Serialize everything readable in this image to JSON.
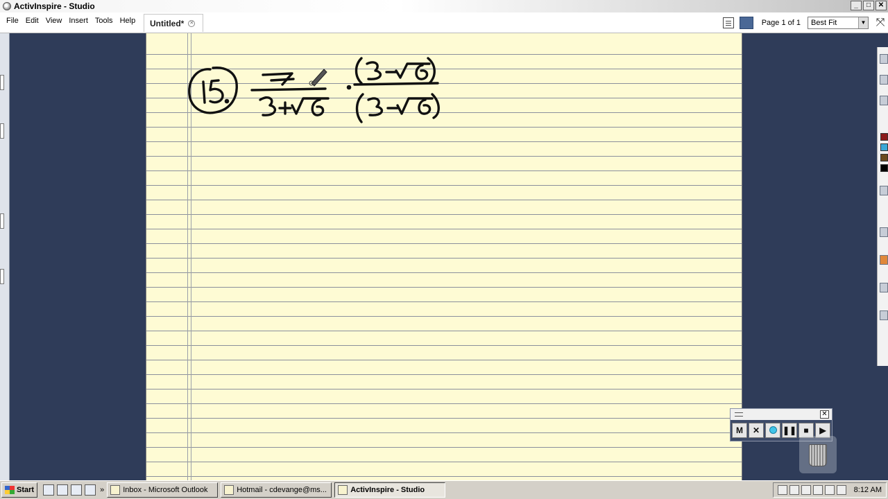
{
  "window": {
    "title": "ActivInspire - Studio",
    "controls": [
      "_",
      "□",
      "✕"
    ]
  },
  "menu": {
    "items": [
      "File",
      "Edit",
      "View",
      "Insert",
      "Tools",
      "Help"
    ]
  },
  "document_tab": {
    "label": "Untitled*"
  },
  "toolbar": {
    "page_label": "Page 1 of 1",
    "zoom_value": "Best Fit"
  },
  "recorder": {
    "buttons": [
      "M",
      "✕",
      "record",
      "❚❚",
      "■",
      "▶"
    ]
  },
  "taskbar": {
    "start_label": "Start",
    "tasks": [
      {
        "label": "Inbox - Microsoft Outlook",
        "active": false
      },
      {
        "label": "Hotmail - cdevange@ms...",
        "active": false
      },
      {
        "label": "ActivInspire - Studio",
        "active": true
      }
    ],
    "clock": "8:12 AM"
  },
  "colors": {
    "paper": "#fefbd4",
    "workspace": "#2f3c59",
    "ink": "#111111"
  }
}
